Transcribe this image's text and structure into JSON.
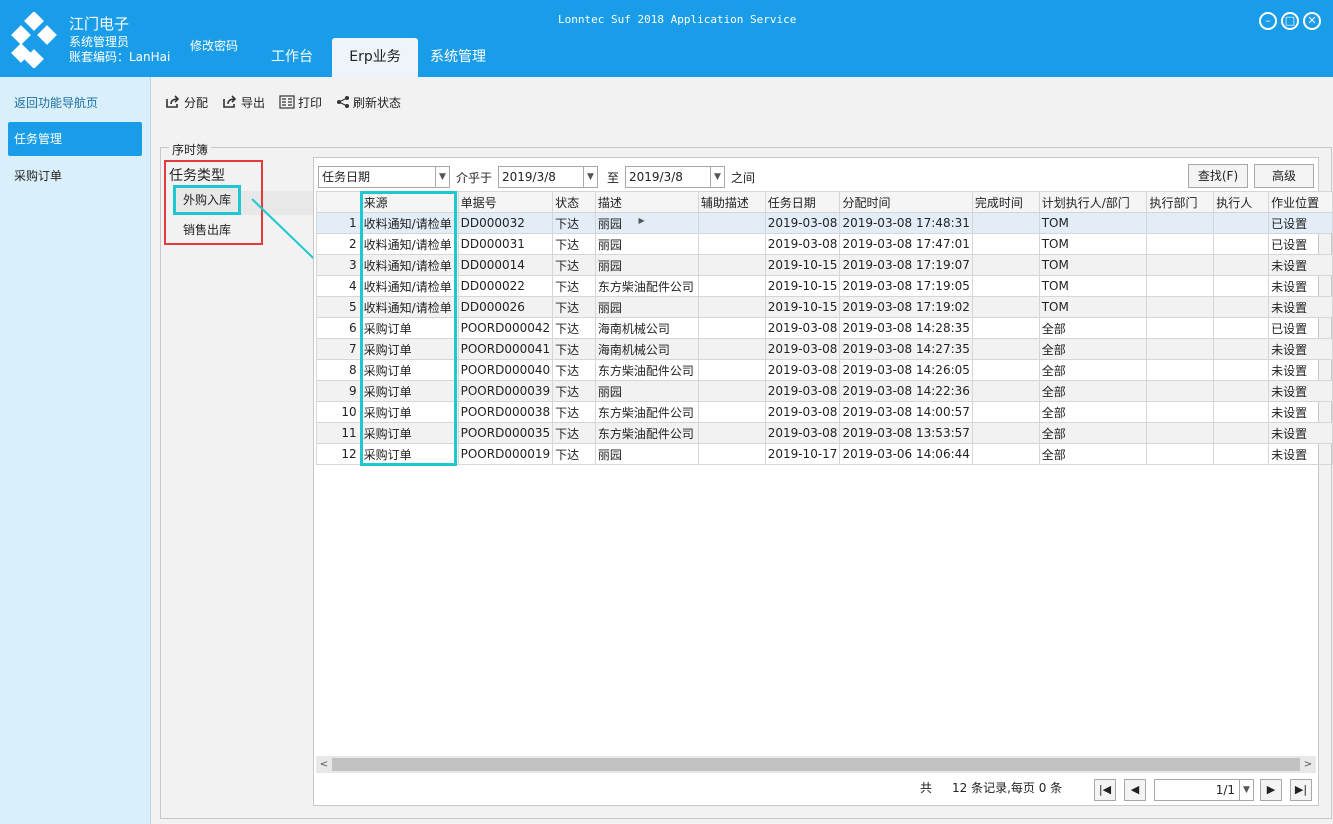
{
  "header": {
    "company": "江门电子",
    "user": "系统管理员",
    "account": "账套编码：LanHai",
    "change_password": "修改密码",
    "app_title": "Lonntec Suf 2018 Application Service",
    "tabs": [
      {
        "label": "工作台"
      },
      {
        "label": "Erp业务"
      },
      {
        "label": "系统管理"
      }
    ]
  },
  "sidebar": {
    "items": [
      {
        "label": "返回功能导航页"
      },
      {
        "label": "任务管理"
      },
      {
        "label": "采购订单"
      }
    ]
  },
  "toolbar": {
    "assign": "分配",
    "export": "导出",
    "print": "打印",
    "refresh": "刷新状态"
  },
  "group_title": "序时簿",
  "task_types": {
    "title": "任务类型",
    "items": [
      "外购入库",
      "销售出库"
    ]
  },
  "filter": {
    "field": "任务日期",
    "between_label": "介乎于",
    "date_from": "2019/3/8",
    "to_label": "至",
    "date_to": "2019/3/8",
    "end_label": "之间",
    "search_button": "查找(F)",
    "advanced_button": "高级"
  },
  "columns": [
    "来源",
    "单据号",
    "状态",
    "描述",
    "辅助描述",
    "任务日期",
    "分配时间",
    "完成时间",
    "计划执行人/部门",
    "执行部门",
    "执行人",
    "作业位置"
  ],
  "rows": [
    [
      "1",
      "收料通知/请检单",
      "DD000032",
      "下达",
      "丽园",
      "",
      "2019-03-08",
      "2019-03-08 17:48:31",
      "",
      "TOM",
      "",
      "",
      "已设置"
    ],
    [
      "2",
      "收料通知/请检单",
      "DD000031",
      "下达",
      "丽园",
      "",
      "2019-03-08",
      "2019-03-08 17:47:01",
      "",
      "TOM",
      "",
      "",
      "已设置"
    ],
    [
      "3",
      "收料通知/请检单",
      "DD000014",
      "下达",
      "丽园",
      "",
      "2019-10-15",
      "2019-03-08 17:19:07",
      "",
      "TOM",
      "",
      "",
      "未设置"
    ],
    [
      "4",
      "收料通知/请检单",
      "DD000022",
      "下达",
      "东方柴油配件公司",
      "",
      "2019-10-15",
      "2019-03-08 17:19:05",
      "",
      "TOM",
      "",
      "",
      "未设置"
    ],
    [
      "5",
      "收料通知/请检单",
      "DD000026",
      "下达",
      "丽园",
      "",
      "2019-10-15",
      "2019-03-08 17:19:02",
      "",
      "TOM",
      "",
      "",
      "未设置"
    ],
    [
      "6",
      "采购订单",
      "POORD000042",
      "下达",
      "海南机械公司",
      "",
      "2019-03-08",
      "2019-03-08 14:28:35",
      "",
      "全部",
      "",
      "",
      "已设置"
    ],
    [
      "7",
      "采购订单",
      "POORD000041",
      "下达",
      "海南机械公司",
      "",
      "2019-03-08",
      "2019-03-08 14:27:35",
      "",
      "全部",
      "",
      "",
      "未设置"
    ],
    [
      "8",
      "采购订单",
      "POORD000040",
      "下达",
      "东方柴油配件公司",
      "",
      "2019-03-08",
      "2019-03-08 14:26:05",
      "",
      "全部",
      "",
      "",
      "未设置"
    ],
    [
      "9",
      "采购订单",
      "POORD000039",
      "下达",
      "丽园",
      "",
      "2019-03-08",
      "2019-03-08 14:22:36",
      "",
      "全部",
      "",
      "",
      "未设置"
    ],
    [
      "10",
      "采购订单",
      "POORD000038",
      "下达",
      "东方柴油配件公司",
      "",
      "2019-03-08",
      "2019-03-08 14:00:57",
      "",
      "全部",
      "",
      "",
      "未设置"
    ],
    [
      "11",
      "采购订单",
      "POORD000035",
      "下达",
      "东方柴油配件公司",
      "",
      "2019-03-08",
      "2019-03-08 13:53:57",
      "",
      "全部",
      "",
      "",
      "未设置"
    ],
    [
      "12",
      "采购订单",
      "POORD000019",
      "下达",
      "丽园",
      "",
      "2019-10-17",
      "2019-03-06 14:06:44",
      "",
      "全部",
      "",
      "",
      "未设置"
    ]
  ],
  "pager": {
    "total_prefix": "共",
    "summary": "12 条记录,每页 0 条",
    "page": "1/1"
  },
  "colors": {
    "header_bg": "#1a9de8",
    "sidebar_bg": "#d9f0fb",
    "highlight_red": "#e23b3b",
    "highlight_cyan": "#1dc8d0"
  }
}
